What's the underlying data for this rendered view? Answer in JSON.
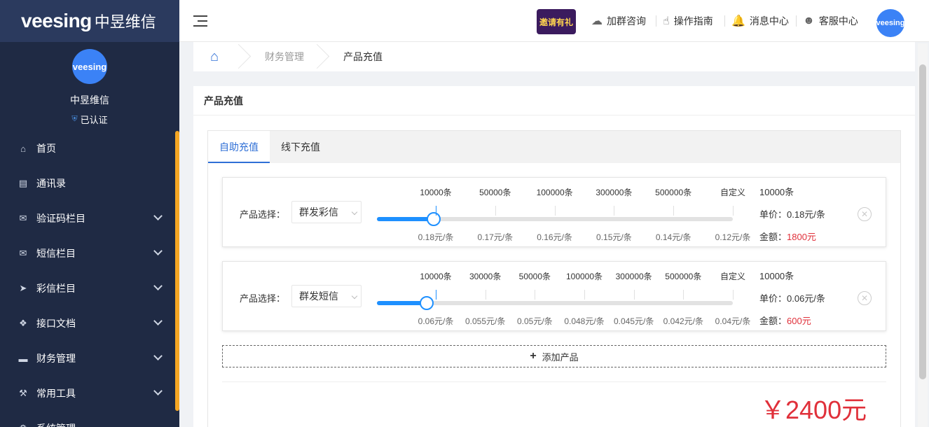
{
  "brand": {
    "logo_latin": "veesing",
    "logo_cn": "中昱维信"
  },
  "profile": {
    "name": "中昱维信",
    "verified": "已认证",
    "avatar_text": "veesing"
  },
  "sidebar": {
    "items": [
      {
        "label": "首页",
        "icon": "home-icon"
      },
      {
        "label": "通讯录",
        "icon": "address-book-icon"
      },
      {
        "label": "验证码栏目",
        "icon": "envelope-open-icon"
      },
      {
        "label": "短信栏目",
        "icon": "envelope-icon"
      },
      {
        "label": "彩信栏目",
        "icon": "paper-plane-icon"
      },
      {
        "label": "接口文档",
        "icon": "cubes-icon"
      },
      {
        "label": "财务管理",
        "icon": "credit-card-icon"
      },
      {
        "label": "常用工具",
        "icon": "wrench-icon"
      },
      {
        "label": "系统管理",
        "icon": "gear-icon"
      }
    ]
  },
  "header": {
    "promo_text": "邀请有礼",
    "links": [
      {
        "label": "加群咨询",
        "icon": "cloud-icon"
      },
      {
        "label": "操作指南",
        "icon": "hand-pointer-icon"
      },
      {
        "label": "消息中心",
        "icon": "bell-icon"
      },
      {
        "label": "客服中心",
        "icon": "support-agent-icon"
      }
    ],
    "avatar_text": "veesing"
  },
  "breadcrumb": {
    "items": [
      "财务管理",
      "产品充值"
    ]
  },
  "panel": {
    "title": "产品充值"
  },
  "tabs": [
    "自助充值",
    "线下充值"
  ],
  "products": [
    {
      "label": "产品选择：",
      "selected": "群发彩信",
      "tiers": [
        "10000条",
        "50000条",
        "100000条",
        "300000条",
        "500000条",
        "自定义"
      ],
      "prices": [
        "0.18元/条",
        "0.17元/条",
        "0.16元/条",
        "0.15元/条",
        "0.14元/条",
        "0.12元/条"
      ],
      "slider_fraction": 0.16,
      "quantity": "10000条",
      "unit_price": "单价：0.18元/条",
      "amount_label": "金额：",
      "amount": "1800元"
    },
    {
      "label": "产品选择：",
      "selected": "群发短信",
      "tiers": [
        "10000条",
        "30000条",
        "50000条",
        "100000条",
        "300000条",
        "500000条",
        "自定义"
      ],
      "prices": [
        "0.06元/条",
        "0.055元/条",
        "0.05元/条",
        "0.048元/条",
        "0.045元/条",
        "0.042元/条",
        "0.04元/条"
      ],
      "slider_fraction": 0.14,
      "quantity": "10000条",
      "unit_price": "单价：0.06元/条",
      "amount_label": "金额：",
      "amount": "600元"
    }
  ],
  "add_product": "添加产品",
  "total": "￥2400元",
  "colors": {
    "sidebar_bg": "#1f2a44",
    "accent_blue": "#1e90ff",
    "price_red": "#e0303a",
    "scroll_accent": "#f5a623"
  }
}
